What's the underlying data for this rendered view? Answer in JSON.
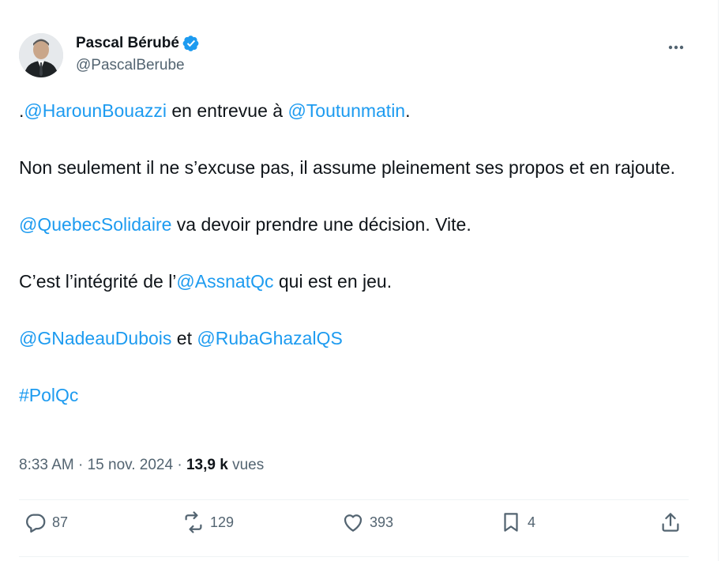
{
  "author": {
    "name": "Pascal Bérubé",
    "handle": "@PascalBerube",
    "avatar": "avatar-photo",
    "verified_icon": "verified-badge-icon"
  },
  "tweet": {
    "line1": {
      "prefix": ".",
      "mention1": "@HarounBouazzi",
      "mid": " en entrevue à ",
      "mention2": "@Toutunmatin",
      "suffix": "."
    },
    "line2": "Non seulement il ne s’excuse pas, il assume pleinement ses propos et en rajoute.",
    "line3": {
      "mention": "@QuebecSolidaire",
      "text": " va devoir prendre une décision. Vite."
    },
    "line4": {
      "prefix": "C’est l’intégrité de l’",
      "mention": "@AssnatQc",
      "suffix": " qui est en jeu."
    },
    "line5": {
      "mention1": "@GNadeauDubois",
      "mid": " et ",
      "mention2": "@RubaGhazalQS"
    },
    "hashtag": "#PolQc"
  },
  "meta": {
    "time": "8:33 AM",
    "sep1": " · ",
    "date": "15 nov. 2024",
    "sep2": " · ",
    "views": "13,9 k",
    "views_label": " vues"
  },
  "actions": {
    "replies": "87",
    "retweets": "129",
    "likes": "393",
    "bookmarks": "4"
  },
  "colors": {
    "link": "#1d9bf0",
    "text": "#0f1419",
    "secondary": "#536471",
    "divider": "#eff3f4"
  }
}
